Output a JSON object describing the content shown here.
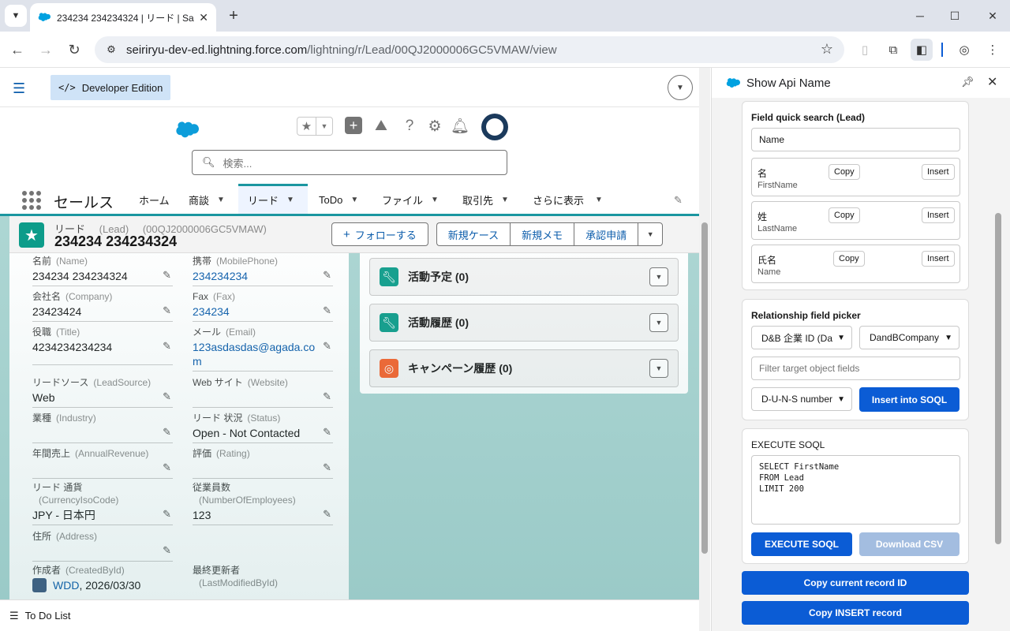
{
  "browser": {
    "tab_title": "234234 234234324 | リード | Sa",
    "url_host": "seiriryu-dev-ed.lightning.force.com",
    "url_path": "/lightning/r/Lead/00QJ2000006GC5VMAW/view"
  },
  "sf": {
    "edition_badge": "Developer Edition",
    "search_placeholder": "検索...",
    "app_name": "セールス",
    "nav": [
      {
        "label": "ホーム"
      },
      {
        "label": "商談"
      },
      {
        "label": "リード"
      },
      {
        "label": "ToDo"
      },
      {
        "label": "ファイル"
      },
      {
        "label": "取引先"
      },
      {
        "label": "さらに表示"
      }
    ],
    "record": {
      "entity": "リード",
      "entity_api": "(Lead)",
      "record_id": "(00QJ2000006GC5VMAW)",
      "name": "234234 234234324"
    },
    "actions": {
      "follow": "フォローする",
      "new_case": "新規ケース",
      "new_note": "新規メモ",
      "approval": "承認申請"
    },
    "fields": {
      "name": {
        "label": "名前",
        "api": "(Name)",
        "value": "234234 234234324"
      },
      "mobile": {
        "label": "携帯",
        "api": "(MobilePhone)",
        "value": "234234234"
      },
      "company": {
        "label": "会社名",
        "api": "(Company)",
        "value": "23423424"
      },
      "fax": {
        "label": "Fax",
        "api": "(Fax)",
        "value": "234234"
      },
      "title": {
        "label": "役職",
        "api": "(Title)",
        "value": "4234234234234"
      },
      "email": {
        "label": "メール",
        "api": "(Email)",
        "value": "123asdasdas@agada.com"
      },
      "leadsource": {
        "label": "リードソース",
        "api": "(LeadSource)",
        "value": "Web"
      },
      "website": {
        "label": "Web サイト",
        "api": "(Website)",
        "value": ""
      },
      "industry": {
        "label": "業種",
        "api": "(Industry)",
        "value": ""
      },
      "status": {
        "label": "リード 状況",
        "api": "(Status)",
        "value": "Open - Not Contacted"
      },
      "revenue": {
        "label": "年間売上",
        "api": "(AnnualRevenue)",
        "value": ""
      },
      "rating": {
        "label": "評価",
        "api": "(Rating)",
        "value": ""
      },
      "currency": {
        "label": "リード 通貨",
        "api": "(CurrencyIsoCode)",
        "value": "JPY - 日本円"
      },
      "employees": {
        "label": "従業員数",
        "api": "(NumberOfEmployees)",
        "value": "123"
      },
      "address": {
        "label": "住所",
        "api": "(Address)",
        "value": ""
      },
      "createdby": {
        "label": "作成者",
        "api": "(CreatedById)",
        "value": "WDD",
        "date": ", 2026/03/30"
      },
      "modifiedby": {
        "label": "最終更新者",
        "api": "(LastModifiedById)",
        "value": ""
      }
    },
    "activities": [
      {
        "title": "活動予定 (0)",
        "color": "#0d9c8a"
      },
      {
        "title": "活動履歴 (0)",
        "color": "#0d9c8a"
      },
      {
        "title": "キャンペーン履歴 (0)",
        "color": "#f4622c"
      }
    ],
    "utility": "To Do List"
  },
  "panel": {
    "title": "Show Api Name",
    "quick_search": {
      "title": "Field quick search (Lead)",
      "value": "Name",
      "items": [
        {
          "jp": "名",
          "en": "FirstName"
        },
        {
          "jp": "姓",
          "en": "LastName"
        },
        {
          "jp": "氏名",
          "en": "Name"
        }
      ],
      "copy": "Copy",
      "insert": "Insert"
    },
    "relationship": {
      "title": "Relationship field picker",
      "select1": "D&B 企業 ID (Da",
      "select2": "DandBCompany",
      "filter_placeholder": "Filter target object fields",
      "select3": "D-U-N-S number",
      "insert_button": "Insert into SOQL"
    },
    "soql": {
      "title": "EXECUTE SOQL",
      "query": "SELECT FirstName\nFROM Lead\nLIMIT 200",
      "execute": "EXECUTE SOQL",
      "download": "Download CSV"
    },
    "copy_id": "Copy current record ID",
    "copy_insert": "Copy INSERT record"
  },
  "colors": {
    "sf_blue": "#0b5cab",
    "teal": "#1b96a0",
    "panel_button": "#0b5cd5",
    "background": "#a9d4d1"
  }
}
